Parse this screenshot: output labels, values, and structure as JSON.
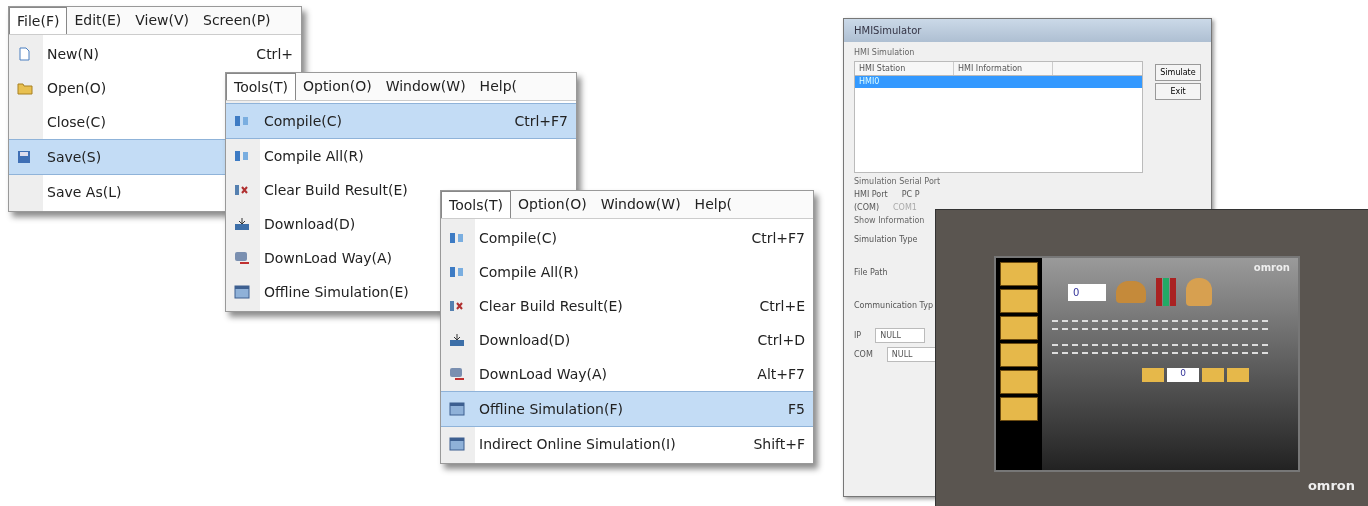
{
  "menus": [
    {
      "menubar": [
        {
          "label": "File(F)",
          "selected": true
        },
        {
          "label": "Edit(E)",
          "selected": false
        },
        {
          "label": "View(V)",
          "selected": false
        },
        {
          "label": "Screen(P)",
          "selected": false
        }
      ],
      "items": [
        {
          "kind": "new",
          "label": "New(N)",
          "shortcut": "Ctrl+",
          "selected": false
        },
        {
          "kind": "open",
          "label": "Open(O)",
          "selected": false
        },
        {
          "kind": "plain",
          "label": "Close(C)",
          "selected": false
        },
        {
          "kind": "save",
          "label": "Save(S)",
          "selected": true
        },
        {
          "kind": "plain",
          "label": "Save As(L)",
          "selected": false
        }
      ]
    },
    {
      "menubar": [
        {
          "label": "Tools(T)",
          "selected": true
        },
        {
          "label": "Option(O)",
          "selected": false
        },
        {
          "label": "Window(W)",
          "selected": false
        },
        {
          "label": "Help(",
          "selected": false
        }
      ],
      "items": [
        {
          "kind": "compile",
          "label": "Compile(C)",
          "shortcut": "Ctrl+F7",
          "selected": true
        },
        {
          "kind": "compile",
          "label": "Compile All(R)",
          "selected": false
        },
        {
          "kind": "clear",
          "label": "Clear Build Result(E)",
          "selected": false
        },
        {
          "kind": "download",
          "label": "Download(D)",
          "selected": false
        },
        {
          "kind": "way",
          "label": "DownLoad Way(A)",
          "selected": false
        },
        {
          "kind": "sim",
          "label": "Offline Simulation(E)",
          "selected": false
        }
      ]
    },
    {
      "menubar": [
        {
          "label": "Tools(T)",
          "selected": true
        },
        {
          "label": "Option(O)",
          "selected": false
        },
        {
          "label": "Window(W)",
          "selected": false
        },
        {
          "label": "Help(",
          "selected": false
        }
      ],
      "items": [
        {
          "kind": "compile",
          "label": "Compile(C)",
          "shortcut": "Ctrl+F7",
          "selected": false
        },
        {
          "kind": "compile",
          "label": "Compile All(R)",
          "selected": false
        },
        {
          "kind": "clear",
          "label": "Clear Build Result(E)",
          "shortcut": "Ctrl+E",
          "selected": false
        },
        {
          "kind": "download",
          "label": "Download(D)",
          "shortcut": "Ctrl+D",
          "selected": false
        },
        {
          "kind": "way",
          "label": "DownLoad Way(A)",
          "shortcut": "Alt+F7",
          "selected": false
        },
        {
          "kind": "sim",
          "label": "Offline Simulation(F)",
          "shortcut": "F5",
          "selected": true
        },
        {
          "kind": "sim",
          "label": "Indirect Online Simulation(I)",
          "shortcut": "Shift+F",
          "selected": false
        }
      ]
    }
  ],
  "simulator": {
    "title": "HMISimulator",
    "group": "HMI Simulation",
    "columns": [
      "HMI Station",
      "HMI Information"
    ],
    "rows": [
      {
        "cells": [
          "HMI0",
          ""
        ],
        "selected": true
      }
    ],
    "buttons": [
      "Simulate",
      "Exit"
    ],
    "serial_group": "Simulation Serial Port",
    "serial_labels": [
      "HMI Port",
      "PC P"
    ],
    "com_label": "(COM)",
    "com_value": "COM1",
    "info_group": "Show Information",
    "info_labels": [
      "Simulation Type",
      "File Path",
      "Communication Typ"
    ],
    "ip_label": "IP",
    "ip_value": "NULL",
    "com2_label": "COM",
    "com2_value": "NULL"
  },
  "hmi": {
    "brand": "omron",
    "screen_brand": "omron",
    "count_value": "0",
    "input_value": "0"
  }
}
